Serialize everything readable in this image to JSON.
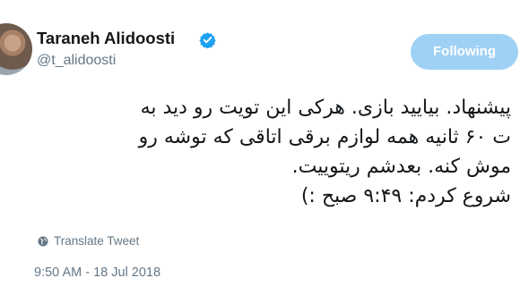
{
  "user": {
    "display_name": "Taraneh Alidoosti",
    "handle": "@t_alidoosti",
    "verified": true
  },
  "follow_button": {
    "label": "Following"
  },
  "tweet": {
    "lines": [
      "پیشنهاد. بیایید بازی. هرکی این تویت رو دید به",
      "ت ۶۰ ثانیه همه لوازم برقی اتاقی که توشه رو",
      "موش کنه. بعدشم ریتوییت.",
      "شروع کردم: ۹:۴۹ صبح :)"
    ],
    "translate_label": "Translate Tweet",
    "timestamp": "9:50 AM - 18 Jul 2018"
  },
  "colors": {
    "follow_button_bg": "#9fd1f5",
    "verified_badge": "#1da1f2",
    "secondary_text": "#657786",
    "primary_text": "#14171a"
  },
  "icons": [
    "verified-badge-icon",
    "globe-icon"
  ]
}
